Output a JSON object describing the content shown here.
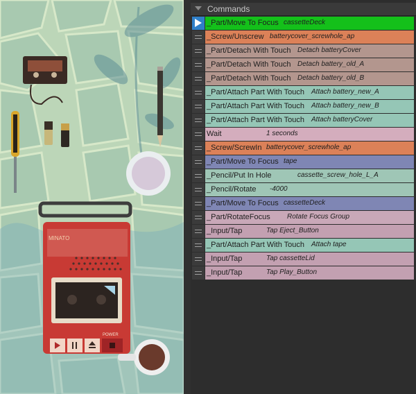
{
  "panel": {
    "title": "Commands"
  },
  "colors": {
    "active": "#14c01a",
    "screw": "#dc8158",
    "detach": "#b3968e",
    "attach": "#95c6b6",
    "wait": "#d4adbd",
    "focus": "#7f86b4",
    "pencil": "#9fc6b6",
    "rotate_focus": "#c9a8b8",
    "input": "#c3a0b1"
  },
  "commands": [
    {
      "name": "_Part/Move To Focus",
      "arg": "cassetteDeck",
      "color": "active",
      "running": true
    },
    {
      "name": "_Screw/Unscrew",
      "arg": "batterycover_screwhole_ap",
      "color": "screw"
    },
    {
      "name": "_Part/Detach With Touch",
      "arg": "Detach batteryCover",
      "color": "detach"
    },
    {
      "name": "_Part/Detach With Touch",
      "arg": "Detach battery_old_A",
      "color": "detach"
    },
    {
      "name": "_Part/Detach With Touch",
      "arg": "Detach battery_old_B",
      "color": "detach"
    },
    {
      "name": "_Part/Attach Part With Touch",
      "arg": "Attach battery_new_A",
      "color": "attach"
    },
    {
      "name": "_Part/Attach Part With Touch",
      "arg": "Attach battery_new_B",
      "color": "attach"
    },
    {
      "name": "_Part/Attach Part With Touch",
      "arg": "Attach batteryCover",
      "color": "attach"
    },
    {
      "name": "Wait",
      "arg": "1 seconds",
      "color": "wait"
    },
    {
      "name": "_Screw/ScrewIn",
      "arg": "batterycover_screwhole_ap",
      "color": "screw"
    },
    {
      "name": "_Part/Move To Focus",
      "arg": "tape",
      "color": "focus"
    },
    {
      "name": "_Pencil/Put In Hole",
      "arg": "cassette_screw_hole_L_A",
      "color": "pencil"
    },
    {
      "name": "_Pencil/Rotate",
      "arg": "-4000",
      "color": "pencil"
    },
    {
      "name": "_Part/Move To Focus",
      "arg": "cassetteDeck",
      "color": "focus"
    },
    {
      "name": "_Part/RotateFocus",
      "arg": "Rotate Focus Group",
      "color": "rotate_focus"
    },
    {
      "name": "_Input/Tap",
      "arg": "Tap Eject_Button",
      "color": "input"
    },
    {
      "name": "_Part/Attach Part With Touch",
      "arg": "Attach tape",
      "color": "attach"
    },
    {
      "name": "_Input/Tap",
      "arg": "Tap cassetteLid",
      "color": "input"
    },
    {
      "name": "_Input/Tap",
      "arg": "Tap Play_Button",
      "color": "input"
    }
  ],
  "scene": {
    "deck_brand": "MINATO",
    "power_label": "POWER",
    "icons": [
      "play-icon",
      "pause-icon",
      "eject-icon",
      "stop-icon"
    ]
  }
}
